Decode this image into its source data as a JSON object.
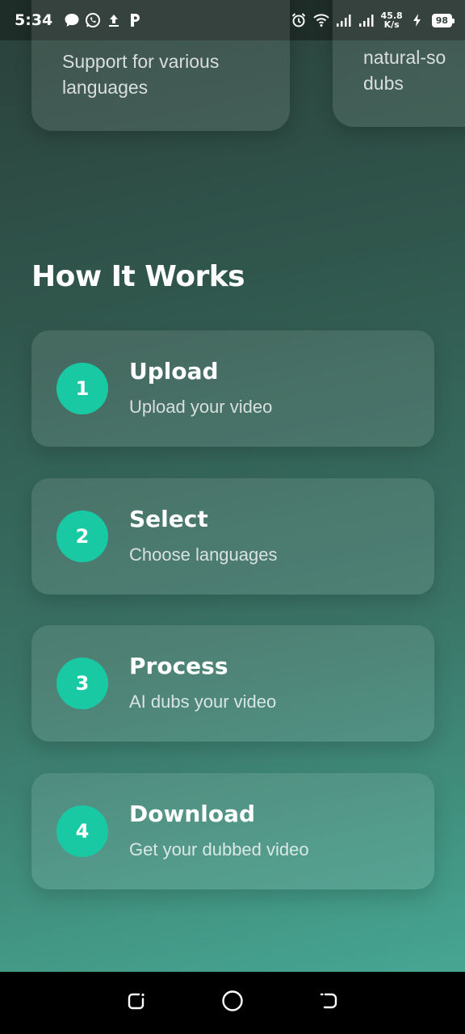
{
  "status_bar": {
    "time": "5:34",
    "left_icons": [
      "chat-bubble-icon",
      "whatsapp-icon",
      "upload-icon",
      "p-app-icon"
    ],
    "right_icons": [
      "alarm-icon",
      "wifi-icon",
      "signal-icon",
      "signal-icon-2"
    ],
    "net_speed_value": "45.8",
    "net_speed_unit": "K/s",
    "battery_level": "98"
  },
  "features": [
    {
      "text": "Support for various\nlanguages"
    },
    {
      "text": "natural-so\ndubs"
    }
  ],
  "how_it_works": {
    "title": "How It Works",
    "steps": [
      {
        "number": "1",
        "title": "Upload",
        "description": "Upload your video"
      },
      {
        "number": "2",
        "title": "Select",
        "description": "Choose languages"
      },
      {
        "number": "3",
        "title": "Process",
        "description": "AI dubs your video"
      },
      {
        "number": "4",
        "title": "Download",
        "description": "Get your dubbed video"
      }
    ]
  },
  "nav_bar": [
    "recent-apps-icon",
    "home-icon",
    "back-icon"
  ],
  "colors": {
    "accent": "#19c9a4",
    "background_top": "#2a403a",
    "background_bottom": "#46a692"
  }
}
